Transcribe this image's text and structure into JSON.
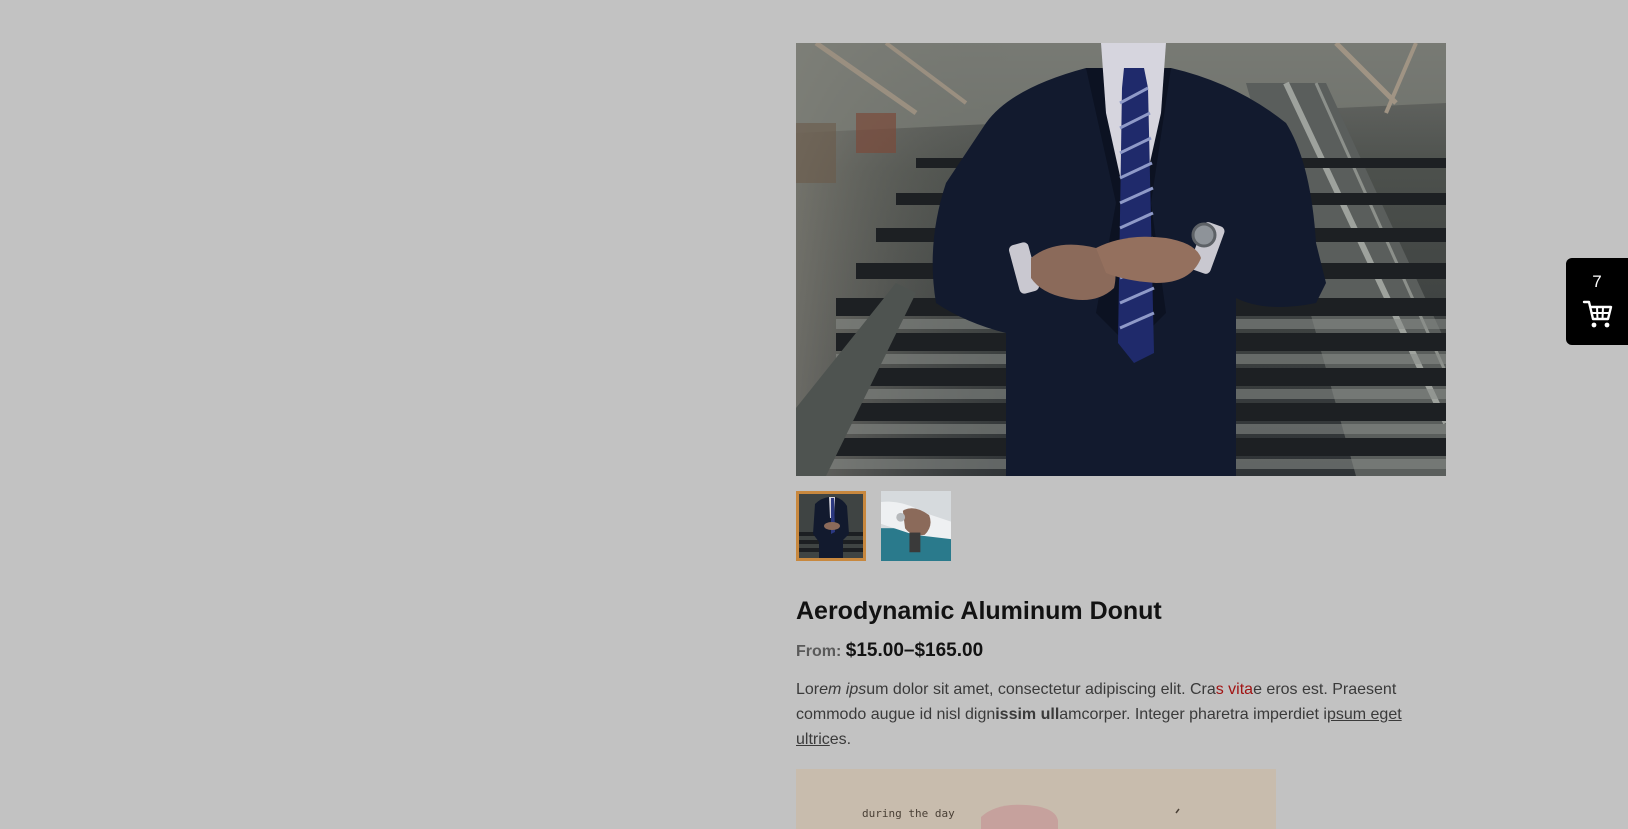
{
  "product": {
    "title": "Aerodynamic Aluminum Donut",
    "price_prefix": "From:",
    "price_range": "$15.00–$165.00",
    "description": {
      "s1": "Lor",
      "s2": "em ips",
      "s3": "um dolor sit amet, consectetur adipiscing elit. Cra",
      "s4": "s vita",
      "s5": "e eros est. Praesent commodo augue id nisl dign",
      "s6": "issim ull",
      "s7": "amcorper. Integer pharetra imperdiet i",
      "s8": "psum eget ultric",
      "s9": "es."
    },
    "thumbnails": [
      {
        "name": "suit-buttoning",
        "active": true
      },
      {
        "name": "cufflinks",
        "active": false
      }
    ],
    "promo_text": "during the day"
  },
  "cart": {
    "count": "7",
    "icon": "cart-icon"
  },
  "colors": {
    "overlay_background": "#c2c2c2",
    "thumb_active_border": "#c8883e",
    "accent_red": "#a11414",
    "cart_background": "#000000"
  }
}
